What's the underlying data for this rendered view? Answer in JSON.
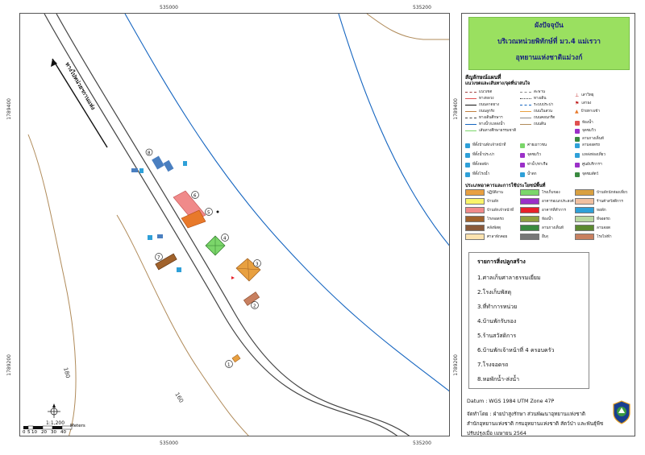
{
  "title": {
    "line1": "ผังปัจจุบัน",
    "line2": "บริเวณหน่วยพิทักษ์ที่ มว.4 แม่เรวา",
    "line3": "อุทยานแห่งชาติแม่วงก์"
  },
  "map": {
    "coords_top": [
      "535000",
      "535200"
    ],
    "coords_bottom": [
      "535000",
      "535200"
    ],
    "coords_left": [
      "1789400",
      "1789200"
    ],
    "coords_right": [
      "1789400",
      "1789200"
    ],
    "road_label": "ทางไปหน่วยฯกานแห่ง",
    "contours": [
      "180",
      "160"
    ],
    "scale": "1:1,200",
    "scale_ticks": [
      "0",
      "5",
      "10",
      "20",
      "30",
      "40"
    ],
    "scale_unit": "Meters",
    "building_markers": [
      "1",
      "2",
      "3",
      "4",
      "5",
      "6",
      "7",
      "8"
    ],
    "colors": {
      "road": "#555555",
      "stream": "#1565c0",
      "contour": "#b08b5a",
      "building_orange": "#e8792a",
      "building_pink": "#f08a8a",
      "building_brown": "#a0622c",
      "building_green": "#7bd66a",
      "building_blue": "#4a7fc0"
    }
  },
  "legend": {
    "section_title": "สัญลักษณ์แผนที่",
    "subsection_title": "แนวเขตและเส้นทาง/จุดที่น่าสนใจ",
    "lines_col1": [
      "แนวเขต",
      "ทางหลวง",
      "ถนนลาดยาง",
      "ถนนลูกรัง",
      "ทางเดินศึกษาฯ",
      "ทางน้ำ/แหล่งน้ำ",
      "เส้นทางศึกษาธรรมชาติ"
    ],
    "lines_col2": [
      "สะพาน",
      "ทางเดิน",
      "ระบบประปา",
      "ถนนในสวน",
      "ถนนคอนกรีต",
      "ถนนดิน"
    ],
    "points_col3": [
      "เสาวิทยุ",
      "เสาธง",
      "ป้ายทางเข้า",
      "ห้องน้ำ",
      "จุดชมวิว",
      "ลานกางเต็นท์"
    ],
    "points_col1": [
      "ที่ตั้งบ้านพักเจ้าหน้าที่",
      "ที่ตั้งน้ำประปา",
      "ที่ตั้งหอพัก",
      "ที่ตั้งโรงน้ำ"
    ],
    "points_col2": [
      "ค่ายเยาวชน",
      "จุดชมวิว",
      "ท่าน้ำ/ท่าเรือ",
      "น้ำตก"
    ],
    "points_col3b": [
      "ลานจอดรถ",
      "แหล่งท่องเที่ยว",
      "ศูนย์บริการฯ",
      "จุดชมสัตว์"
    ],
    "usage_title": "ประเภทอาคารและการใช้ประโยชน์พื้นที่",
    "usage": [
      {
        "label": "ปฏิบัติงาน",
        "color": "#e8a040"
      },
      {
        "label": "บ้านพัก",
        "color": "#f9f46a"
      },
      {
        "label": "บ้านพักเจ้าหน้าที่",
        "color": "#f08a8a"
      },
      {
        "label": "โรงจอดรถ",
        "color": "#a0622c"
      },
      {
        "label": "คลังพัสดุ",
        "color": "#8a5a3a"
      },
      {
        "label": "ศาลาพักคอย",
        "color": "#fbe3b0"
      },
      {
        "label": "โรงเก็บของ",
        "color": "#7bd66a"
      },
      {
        "label": "อาคารอเนกประสงค์",
        "color": "#9b30c8"
      },
      {
        "label": "อาคารที่ทำการ",
        "color": "#e8202a"
      },
      {
        "label": "ห้องน้ำ",
        "color": "#8fa040"
      },
      {
        "label": "ลานกางเต็นท์",
        "color": "#3a8a40"
      },
      {
        "label": "อื่นๆ",
        "color": "#777777"
      },
      {
        "label": "บ้านพักนักท่องเที่ยว",
        "color": "#d9a040"
      },
      {
        "label": "ร้านค้าสวัสดิการ",
        "color": "#f0c0a0"
      },
      {
        "label": "หอพัก",
        "color": "#2fa0d8"
      },
      {
        "label": "ที่จอดรถ",
        "color": "#b8d8a0"
      },
      {
        "label": "ลานจอด",
        "color": "#5c8a30"
      },
      {
        "label": "โรงไฟฟ้า",
        "color": "#c88060"
      }
    ]
  },
  "buildings_list": {
    "title": "รายการสิ่งปลูกสร้าง",
    "items": [
      "1.ศาลเก็บศาลาธรรมเยี่ยม",
      "2.โรงเก็บพัสดุ",
      "3.ที่ทำการหน่วย",
      "4.บ้านพักรับรอง",
      "5.ร้านสวัสดิการ",
      "6.บ้านพักเจ้าหน้าที่ 4 ครอบครัว",
      "7.โรงจอดรถ",
      "8.หอพักน้ำ-ส่งน้ำ"
    ]
  },
  "footer": {
    "datum": "Datum  :  WGS 1984 UTM Zone 47P",
    "made_by": "จัดทำโดย  :  ฝ่ายป่าสูงรักษา ส่วนพัฒนาอุทยานแห่งชาติ",
    "dept": "สำนักอุทยานแห่งชาติ  กรมอุทยานแห่งชาติ สัตว์ป่า และพันธุ์พืช",
    "updated": "ปรับปรุงเมื่อ  เมษายน 2564"
  }
}
